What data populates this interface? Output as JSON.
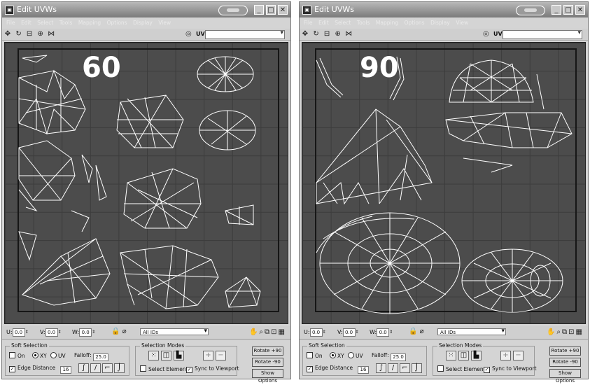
{
  "windows": [
    {
      "title": "Edit UVWs",
      "menu": [
        "File",
        "Edit",
        "Select",
        "Tools",
        "Mapping",
        "Options",
        "Display",
        "View"
      ],
      "map_label": "UV",
      "label": "60",
      "coords": {
        "u_label": "U:",
        "u_value": "0.0",
        "v_label": "V:",
        "v_value": "0.0",
        "w_label": "W:",
        "w_value": "0.0"
      },
      "filter": "All IDs",
      "soft_selection": {
        "title": "Soft Selection",
        "on": "On",
        "xy": "XY",
        "uv": "UV",
        "falloff_label": "Falloff:",
        "falloff_value": "25.0",
        "edge_distance": "Edge Distance",
        "edge_value": "16"
      },
      "selection_modes": {
        "title": "Selection Modes",
        "select_element": "Select Element",
        "sync_viewport": "Sync to Viewport"
      },
      "buttons": {
        "rotate_plus": "Rotate +90",
        "rotate_minus": "Rotate -90",
        "show_options": "Show Options"
      }
    },
    {
      "title": "Edit UVWs",
      "menu": [
        "File",
        "Edit",
        "Select",
        "Tools",
        "Mapping",
        "Options",
        "Display",
        "View"
      ],
      "map_label": "UV",
      "label": "90",
      "coords": {
        "u_label": "U:",
        "u_value": "0.0",
        "v_label": "V:",
        "v_value": "0.0",
        "w_label": "W:",
        "w_value": "0.0"
      },
      "filter": "All IDs",
      "soft_selection": {
        "title": "Soft Selection",
        "on": "On",
        "xy": "XY",
        "uv": "UV",
        "falloff_label": "Falloff:",
        "falloff_value": "25.0",
        "edge_distance": "Edge Distance",
        "edge_value": "16"
      },
      "selection_modes": {
        "title": "Selection Modes",
        "select_element": "Select Element",
        "sync_viewport": "Sync to Viewport"
      },
      "buttons": {
        "rotate_plus": "Rotate +90",
        "rotate_minus": "Rotate -90",
        "show_options": "Show Options"
      }
    }
  ],
  "colors": {
    "viewport": "#4c4c4c",
    "uv_lines": "#ffffff",
    "panel": "#d4d4d4"
  },
  "icons": [
    "app-icon",
    "minimize-icon",
    "maximize-icon",
    "close-icon",
    "move-icon",
    "rotate-icon",
    "scale-icon",
    "freeform-icon",
    "mirror-icon",
    "map-icon",
    "lock-icon",
    "pan-hand-icon",
    "zoom-icon",
    "zoom-region-icon",
    "zoom-extents-icon",
    "grid-icon"
  ]
}
